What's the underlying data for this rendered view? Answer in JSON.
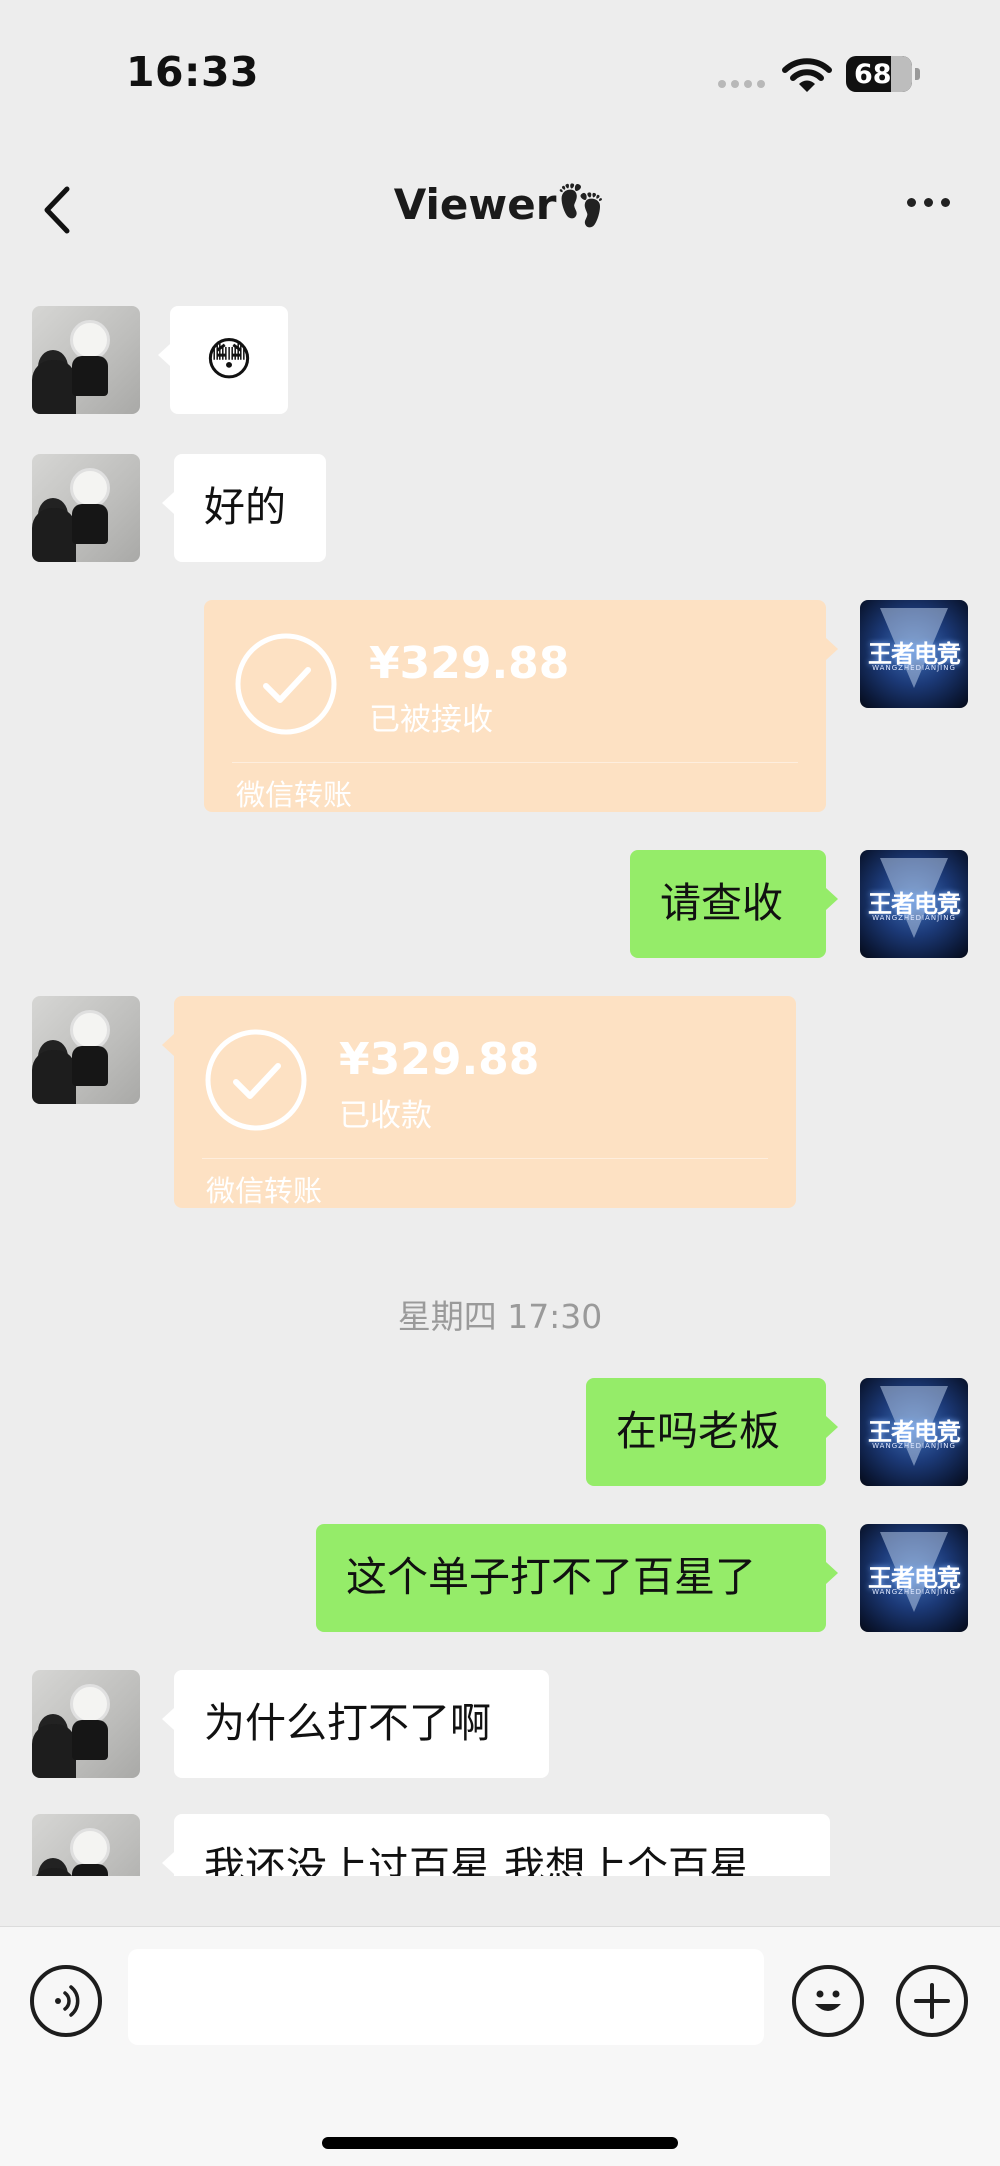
{
  "status": {
    "time": "16:33",
    "battery": "68",
    "battery_level_percent": 68,
    "icons": [
      "signal-dots-icon",
      "wifi-icon",
      "battery-icon"
    ]
  },
  "header": {
    "title": "Viewer",
    "title_emoji": "👣",
    "back_icon": "chevron-left-icon",
    "more_icon": "ellipsis-icon"
  },
  "messages": [
    {
      "side": "left",
      "type": "text",
      "text": "😳"
    },
    {
      "side": "left",
      "type": "text",
      "text": "好的"
    },
    {
      "side": "right",
      "type": "transfer",
      "amount": "¥329.88",
      "status": "已被接收",
      "footer": "微信转账"
    },
    {
      "side": "right",
      "type": "text",
      "text": "请查收"
    },
    {
      "side": "left",
      "type": "transfer",
      "amount": "¥329.88",
      "status": "已收款",
      "footer": "微信转账"
    },
    {
      "type": "timestamp",
      "text": "星期四 17:30"
    },
    {
      "side": "right",
      "type": "text",
      "text": "在吗老板"
    },
    {
      "side": "right",
      "type": "text",
      "text": "这个单子打不了百星了"
    },
    {
      "side": "left",
      "type": "text",
      "text": "为什么打不了啊"
    },
    {
      "side": "left",
      "type": "text",
      "text": "我还没上过百星 我想上个百星"
    }
  ],
  "self_avatar_logo": "王者电竞",
  "self_avatar_sub": "WANGZHEDIANJING",
  "input_bar": {
    "voice_icon": "voice-icon",
    "emoji_icon": "emoji-icon",
    "plus_icon": "plus-icon",
    "placeholder": ""
  },
  "colors": {
    "background": "#ededed",
    "self_bubble": "#95ec69",
    "other_bubble": "#ffffff",
    "transfer_card": "#fde1c3"
  }
}
